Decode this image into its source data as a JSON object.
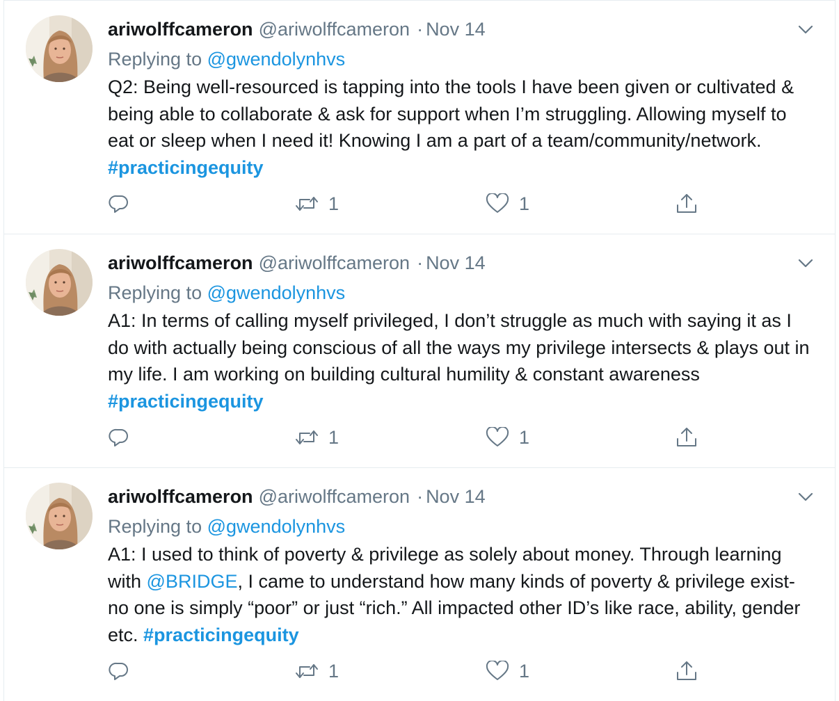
{
  "tweets": [
    {
      "name": "ariwolffcameron",
      "handle": "@ariwolffcameron",
      "separator": "·",
      "date": "Nov 14",
      "replying_prefix": "Replying to",
      "replying_to": "@gwendolynhvs",
      "text_parts": [
        {
          "text": "Q2: Being well-resourced is tapping into the tools I have been given or cultivated & being able to collaborate & ask for support when I’m struggling. Allowing myself to eat or sleep when I need it! Knowing I am a part of a team/community/network. "
        },
        {
          "text": "#practicingequity",
          "kind": "hashtag"
        }
      ],
      "reply_count": "",
      "retweet_count": "1",
      "like_count": "1"
    },
    {
      "name": "ariwolffcameron",
      "handle": "@ariwolffcameron",
      "separator": "·",
      "date": "Nov 14",
      "replying_prefix": "Replying to",
      "replying_to": "@gwendolynhvs",
      "text_parts": [
        {
          "text": "A1: In terms of calling myself privileged, I don’t struggle as much with saying it as I do with actually being conscious of all the ways my privilege intersects & plays out in my life. I am working on building cultural humility & constant awareness "
        },
        {
          "text": "#practicingequity",
          "kind": "hashtag"
        }
      ],
      "reply_count": "",
      "retweet_count": "1",
      "like_count": "1"
    },
    {
      "name": "ariwolffcameron",
      "handle": "@ariwolffcameron",
      "separator": "·",
      "date": "Nov 14",
      "replying_prefix": "Replying to",
      "replying_to": "@gwendolynhvs",
      "text_parts": [
        {
          "text": "A1: I used to think of poverty & privilege as solely about money. Through learning with "
        },
        {
          "text": "@BRIDGE",
          "kind": "mention"
        },
        {
          "text": ", I came to understand how many kinds of poverty & privilege exist- no one is simply “poor” or  just “rich.” All impacted other ID’s like race, ability, gender etc. "
        },
        {
          "text": "#practicingequity",
          "kind": "hashtag"
        }
      ],
      "reply_count": "",
      "retweet_count": "1",
      "like_count": "1"
    }
  ],
  "icons": {
    "avatar": "profile-photo",
    "caret": "chevron-down-icon",
    "reply": "reply-icon",
    "retweet": "retweet-icon",
    "like": "heart-icon",
    "share": "share-icon"
  },
  "colors": {
    "link": "#1b95e0",
    "secondary_text": "#657786",
    "primary_text": "#14171a",
    "divider": "#e6ecf0"
  }
}
